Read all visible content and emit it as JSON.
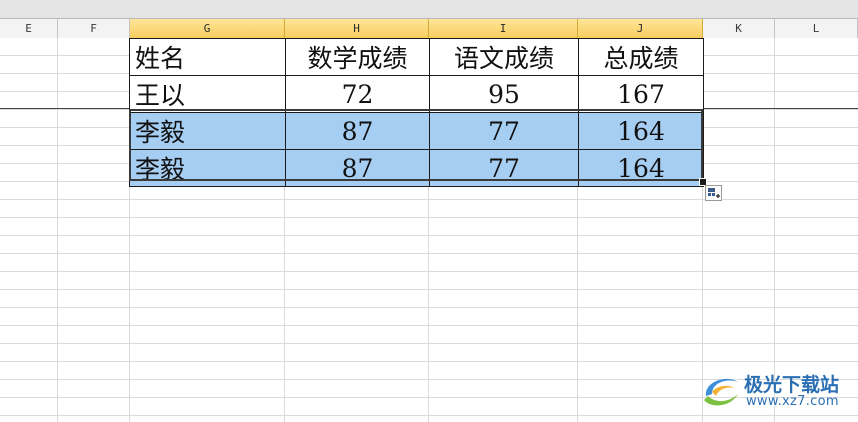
{
  "columns": {
    "E": "E",
    "F": "F",
    "G": "G",
    "H": "H",
    "I": "I",
    "J": "J",
    "K": "K",
    "L": "L"
  },
  "table": {
    "header": [
      "姓名",
      "数学成绩",
      "语文成绩",
      "总成绩"
    ],
    "rows": [
      [
        "王以",
        "72",
        "95",
        "167"
      ],
      [
        "李毅",
        "87",
        "77",
        "164"
      ],
      [
        "李毅",
        "87",
        "77",
        "164"
      ]
    ]
  },
  "selection": {
    "highlight_color": "#a6cdf2",
    "header_highlight": "#f7cd5e"
  },
  "watermark": {
    "brand": "极光下载站",
    "url": "www.xz7.com",
    "color": "#2b6fb3"
  },
  "icons": {
    "paste_options": "paste-options-icon",
    "watermark_logo": "aurora-swirl-icon"
  }
}
